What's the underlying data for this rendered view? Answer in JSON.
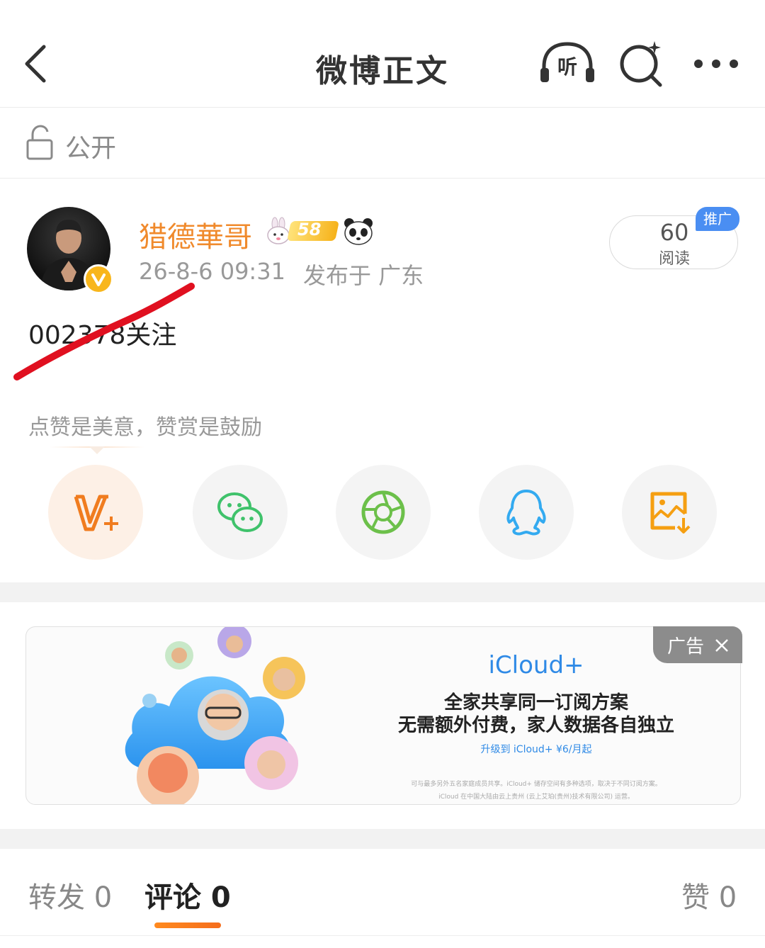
{
  "header": {
    "title": "微博正文",
    "listen_label": "听"
  },
  "visibility": {
    "label": "公开"
  },
  "post": {
    "username": "猎德華哥",
    "level": "58",
    "time": "26-8-6 09:31",
    "location": "发布于 广东",
    "read_count": "60",
    "read_label": "阅读",
    "promo_tag": "推广",
    "text": "002378关注"
  },
  "reward": {
    "tip": "点赞是美意，赞赏是鼓励"
  },
  "share": {
    "icons": [
      "v-plus-icon",
      "wechat-icon",
      "moments-icon",
      "qq-icon",
      "save-image-icon"
    ]
  },
  "ad": {
    "tag": "广告",
    "brand": "iCloud+",
    "headline1": "全家共享同一订阅方案",
    "headline2": "无需额外付费，家人数据各自独立",
    "cta": "升级到 iCloud+ ¥6/月起",
    "fine_print1": "可与最多另外五名家庭成员共享。iCloud+ 储存空间有多种选项，取决于不同订阅方案。",
    "fine_print2": "iCloud 在中国大陆由云上贵州 (云上艾珀(贵州)技术有限公司) 运营。"
  },
  "tabs": {
    "repost": "转发 0",
    "comment": "评论 0",
    "like": "赞 0"
  },
  "colors": {
    "accent_orange": "#f08a2c",
    "brand_blue": "#2f8ae6",
    "promo_blue": "#4a8ef2",
    "wechat_green": "#3fc26b",
    "qq_blue": "#33aaf0",
    "scribble_red": "#e01020"
  }
}
